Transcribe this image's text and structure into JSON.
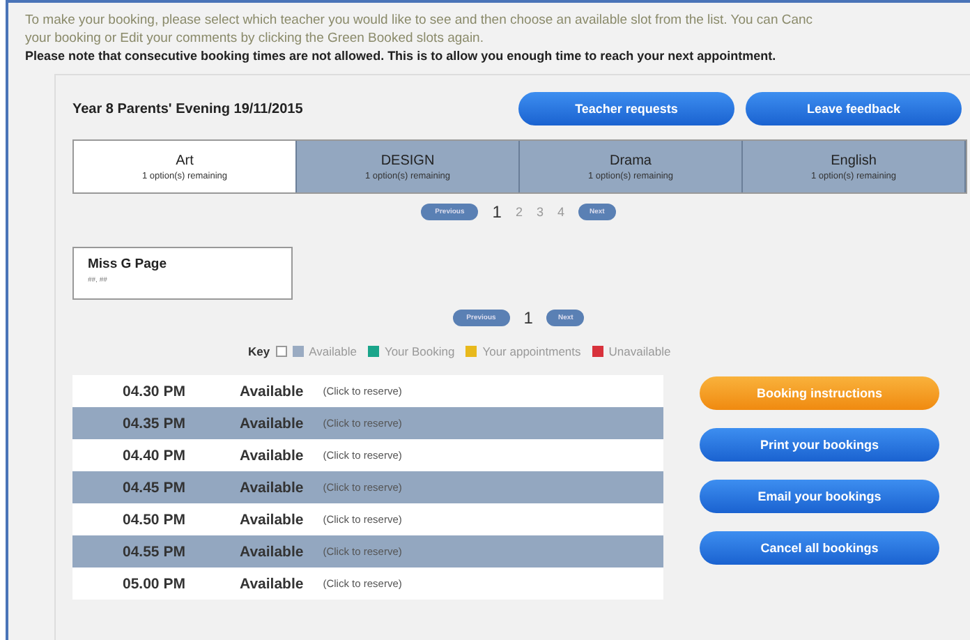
{
  "intro": {
    "lines": [
      "To make your booking, please select which teacher you would like to see and then choose an available slot from the list. You can Canc",
      "your booking or Edit your comments by clicking the Green Booked slots again."
    ],
    "note": "Please note that consecutive booking times are not allowed. This is to allow you enough time to reach your next appointment."
  },
  "heading": "Year 8 Parents' Evening 19/11/2015",
  "header_buttons": [
    "Teacher requests",
    "Leave feedback"
  ],
  "subjects": [
    {
      "name": "Art",
      "remaining": "1 option(s) remaining",
      "selected": true
    },
    {
      "name": "DESIGN",
      "remaining": "1 option(s) remaining",
      "selected": false
    },
    {
      "name": "Drama",
      "remaining": "1 option(s) remaining",
      "selected": false
    },
    {
      "name": "English",
      "remaining": "1 option(s) remaining",
      "selected": false
    }
  ],
  "subject_pager": {
    "previous": "Previous",
    "next": "Next",
    "pages": [
      {
        "label": "1",
        "selected": true
      },
      {
        "label": "2",
        "selected": false
      },
      {
        "label": "3",
        "selected": false
      },
      {
        "label": "4",
        "selected": false
      }
    ]
  },
  "teacher": {
    "name": "Miss G Page",
    "detail": "##, ##"
  },
  "teacher_pager": {
    "previous": "Previous",
    "next": "Next",
    "pages": [
      {
        "label": "1",
        "selected": true
      }
    ]
  },
  "key": {
    "label": "Key",
    "items": [
      {
        "label": "Available",
        "color": "#9aabc2"
      },
      {
        "label": "Your Booking",
        "color": "#1aa58a"
      },
      {
        "label": "Your appointments",
        "color": "#e8b91c"
      },
      {
        "label": "Unavailable",
        "color": "#d8323c"
      }
    ]
  },
  "slots": [
    {
      "time": "04.30 PM",
      "status": "Available",
      "action": "(Click to reserve)"
    },
    {
      "time": "04.35 PM",
      "status": "Available",
      "action": "(Click to reserve)"
    },
    {
      "time": "04.40 PM",
      "status": "Available",
      "action": "(Click to reserve)"
    },
    {
      "time": "04.45 PM",
      "status": "Available",
      "action": "(Click to reserve)"
    },
    {
      "time": "04.50 PM",
      "status": "Available",
      "action": "(Click to reserve)"
    },
    {
      "time": "04.55 PM",
      "status": "Available",
      "action": "(Click to reserve)"
    },
    {
      "time": "05.00 PM",
      "status": "Available",
      "action": "(Click to reserve)"
    }
  ],
  "side_buttons": [
    {
      "label": "Booking instructions",
      "kind": "info"
    },
    {
      "label": "Print your bookings",
      "kind": "action"
    },
    {
      "label": "Email your bookings",
      "kind": "action"
    },
    {
      "label": "Cancel all bookings",
      "kind": "action"
    }
  ]
}
